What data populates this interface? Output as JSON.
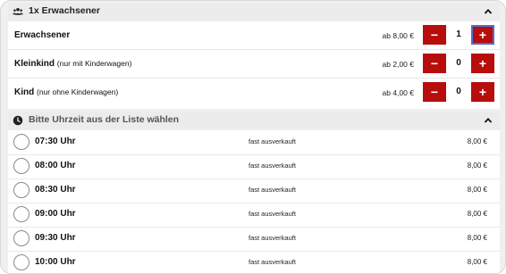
{
  "guests_section": {
    "title": "1x Erwachsener",
    "icon": "people-icon",
    "toggle_icon": "chevron-up-icon"
  },
  "tickets": [
    {
      "name": "Erwachsener",
      "note": "",
      "price": "ab 8,00 €",
      "quantity": "1",
      "minus": "−",
      "plus": "+"
    },
    {
      "name": "Kleinkind",
      "note": "(nur mit Kinderwagen)",
      "price": "ab 2,00 €",
      "quantity": "0",
      "minus": "−",
      "plus": "+"
    },
    {
      "name": "Kind",
      "note": "(nur ohne Kinderwagen)",
      "price": "ab 4,00 €",
      "quantity": "0",
      "minus": "−",
      "plus": "+"
    }
  ],
  "time_section": {
    "title": "Bitte Uhrzeit aus der Liste wählen",
    "icon": "clock-icon",
    "toggle_icon": "chevron-up-icon"
  },
  "slots": [
    {
      "time": "07:30 Uhr",
      "status": "fast ausverkauft",
      "price": "8,00 €"
    },
    {
      "time": "08:00 Uhr",
      "status": "fast ausverkauft",
      "price": "8,00 €"
    },
    {
      "time": "08:30 Uhr",
      "status": "fast ausverkauft",
      "price": "8,00 €"
    },
    {
      "time": "09:00 Uhr",
      "status": "fast ausverkauft",
      "price": "8,00 €"
    },
    {
      "time": "09:30 Uhr",
      "status": "fast ausverkauft",
      "price": "8,00 €"
    },
    {
      "time": "10:00 Uhr",
      "status": "fast ausverkauft",
      "price": "8,00 €"
    }
  ],
  "colors": {
    "accent": "#b80d0d",
    "focus_ring": "#4a6fd1"
  }
}
